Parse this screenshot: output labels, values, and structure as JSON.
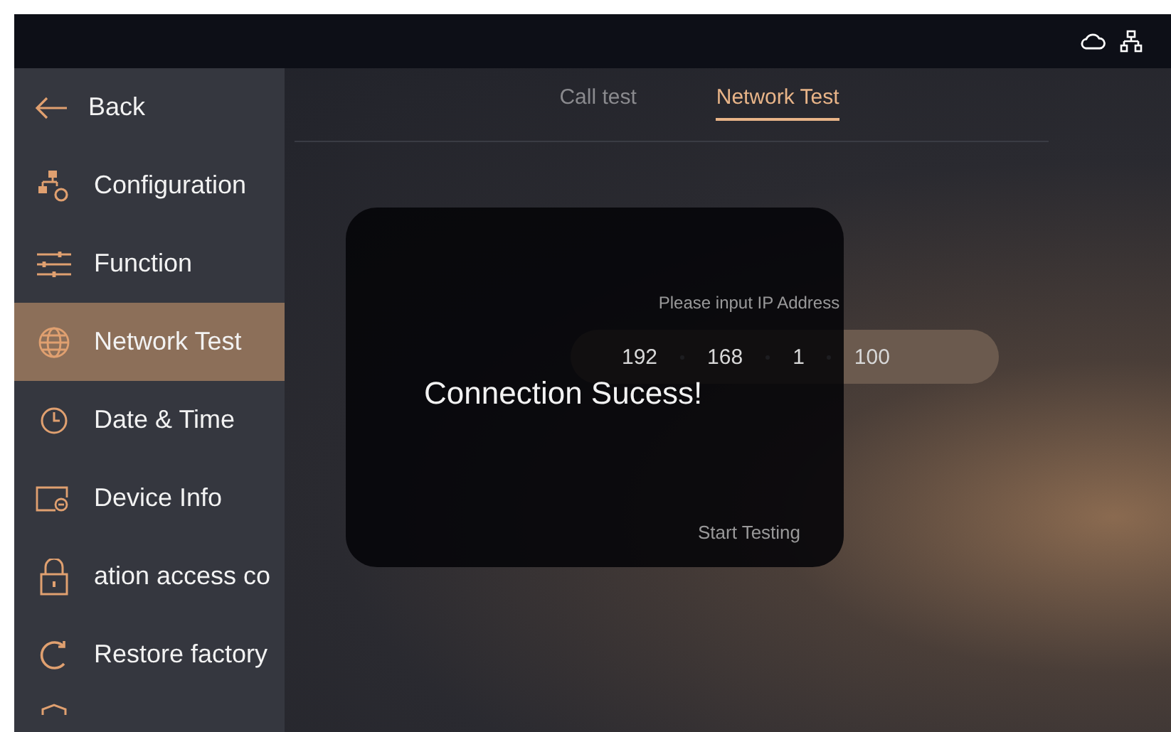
{
  "sidebar": {
    "back": {
      "label": "Back"
    },
    "items": [
      {
        "label": "Configuration",
        "selected": false
      },
      {
        "label": "Function",
        "selected": false
      },
      {
        "label": "Network Test",
        "selected": true
      },
      {
        "label": "Date & Time",
        "selected": false
      },
      {
        "label": "Device Info",
        "selected": false
      },
      {
        "label": "ation access co",
        "selected": false
      },
      {
        "label": "Restore factory",
        "selected": false
      }
    ]
  },
  "tabs": [
    {
      "label": "Call test",
      "selected": false
    },
    {
      "label": "Network Test",
      "selected": true
    }
  ],
  "form": {
    "ip_label": "Please input IP Address",
    "ip_segments": [
      "192",
      "168",
      "1",
      "100"
    ],
    "start_button": "Start Testing"
  },
  "dialog": {
    "message": "Connection Sucess!"
  }
}
